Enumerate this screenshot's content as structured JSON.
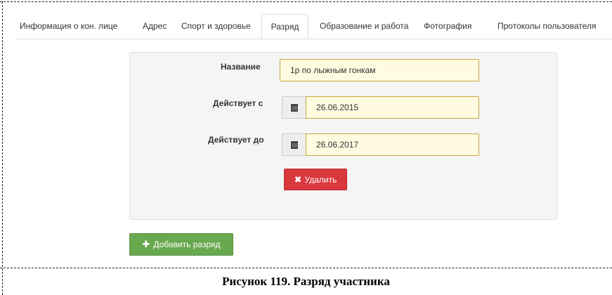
{
  "tabs": [
    {
      "label": "Информация о кон. лице",
      "active": false
    },
    {
      "label": "Адрес",
      "active": false
    },
    {
      "label": "Спорт и здоровье",
      "active": false
    },
    {
      "label": "Разряд",
      "active": true
    },
    {
      "label": "Образование и работа",
      "active": false
    },
    {
      "label": "Фотография",
      "active": false
    },
    {
      "label": "Протоколы пользователя",
      "active": false
    }
  ],
  "form": {
    "name_label": "Название",
    "name_value": "1р по лыжным гонкам",
    "valid_from_label": "Действует с",
    "valid_from_value": "26.06.2015",
    "valid_to_label": "Действует до",
    "valid_to_value": "26.06.2017",
    "calendar_icon": "calendar-icon",
    "delete_icon": "remove-icon",
    "delete_label": "Удалить"
  },
  "actions": {
    "add_icon": "plus-icon",
    "add_label": "Добавить разряд"
  },
  "caption": "Рисунок 119. Разряд участника",
  "colors": {
    "delete_button": "#d9383d",
    "add_button": "#6aa84f",
    "input_bg": "#fffbe0",
    "input_border": "#c9a640",
    "panel_bg": "#f5f5f5"
  }
}
